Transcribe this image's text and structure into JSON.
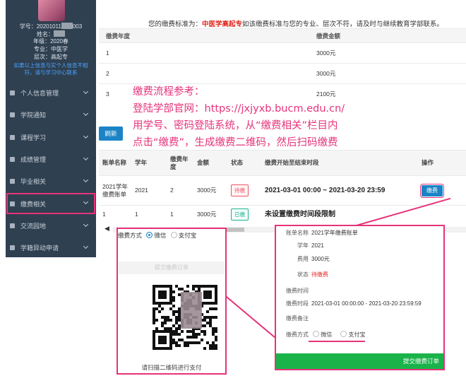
{
  "sidebar": {
    "profile": {
      "student_id_label": "学号：",
      "student_id_prefix": "20201011",
      "student_id_suffix": "003",
      "name_label": "姓名：",
      "grade": "年级：2020春",
      "major": "专业：中医学",
      "level": "层次：高起专",
      "note": "如果以上信息与实个人信息不相符，请与学习中心联系"
    },
    "menu": [
      {
        "label": "个人信息管理"
      },
      {
        "label": "学院通知"
      },
      {
        "label": "课程学习"
      },
      {
        "label": "成绩管理"
      },
      {
        "label": "毕业相关"
      },
      {
        "label": "缴费相关"
      },
      {
        "label": "交流园地"
      },
      {
        "label": "学籍异动申请"
      }
    ]
  },
  "notice": {
    "prefix": "您的缴费标准为：",
    "highlight": "中医学高起专",
    "suffix": "如该缴费标准与您的专业、层次不符，请及时与继续教育学部联系。"
  },
  "fee_table": {
    "headers": [
      "缴费年度",
      "缴费金额"
    ],
    "rows": [
      [
        "1",
        "3000元"
      ],
      [
        "2",
        "3000元"
      ],
      [
        "3",
        "2100元"
      ]
    ]
  },
  "annotation": {
    "line1": "缴费流程参考：",
    "line2": "登陆学部官网：https://jxjyxb.bucm.edu.cn/",
    "line3": "用学号、密码登陆系统，从“缴费相关”栏目内",
    "line4": "点击“缴费”，生成缴费二维码，然后扫码缴费"
  },
  "refresh_label": "刷新",
  "bill_table": {
    "headers": [
      "账单名称",
      "学年",
      "缴费年度",
      "金额",
      "状态",
      "缴费开始至结束时段",
      "操作"
    ],
    "rows": [
      {
        "name": "2021学年缴费账单",
        "year": "2021",
        "fee_year": "2",
        "amount": "3000元",
        "status": "待缴",
        "period": "2021-03-01 00:00 ~ 2021-03-20 23:59",
        "action": "缴费"
      },
      {
        "name": "1",
        "year": "1",
        "fee_year": "1",
        "amount": "3000元",
        "status": "已缴",
        "period": "未设置缴费时间段限制",
        "action": ""
      }
    ]
  },
  "qr_panel": {
    "method_label": "缴费方式",
    "wechat": "微信",
    "alipay": "支付宝",
    "submit": "提交缴费订单",
    "caption": "请扫描二维码进行支付"
  },
  "detail_panel": {
    "rows": [
      {
        "label": "账单名称",
        "value": "2021学年缴费账单"
      },
      {
        "label": "学年",
        "value": "2021"
      },
      {
        "label": "费用",
        "value": "3000元"
      },
      {
        "label": "状态",
        "value": "待缴费"
      },
      {
        "label": "缴费时间",
        "value": ""
      },
      {
        "label": "缴费时段",
        "value": "2021-03-01 00:00:00 - 2021-03-20 23:59:59"
      },
      {
        "label": "缴费备注",
        "value": ""
      }
    ],
    "method_label": "缴费方式",
    "wechat": "微信",
    "alipay": "支付宝",
    "submit": "提交缴费订单"
  },
  "colors": {
    "sidebar_bg": "#2f4050",
    "annotation": "#e6337a",
    "primary": "#1c84c6",
    "success": "#1ab34a",
    "danger": "#e0261d"
  }
}
